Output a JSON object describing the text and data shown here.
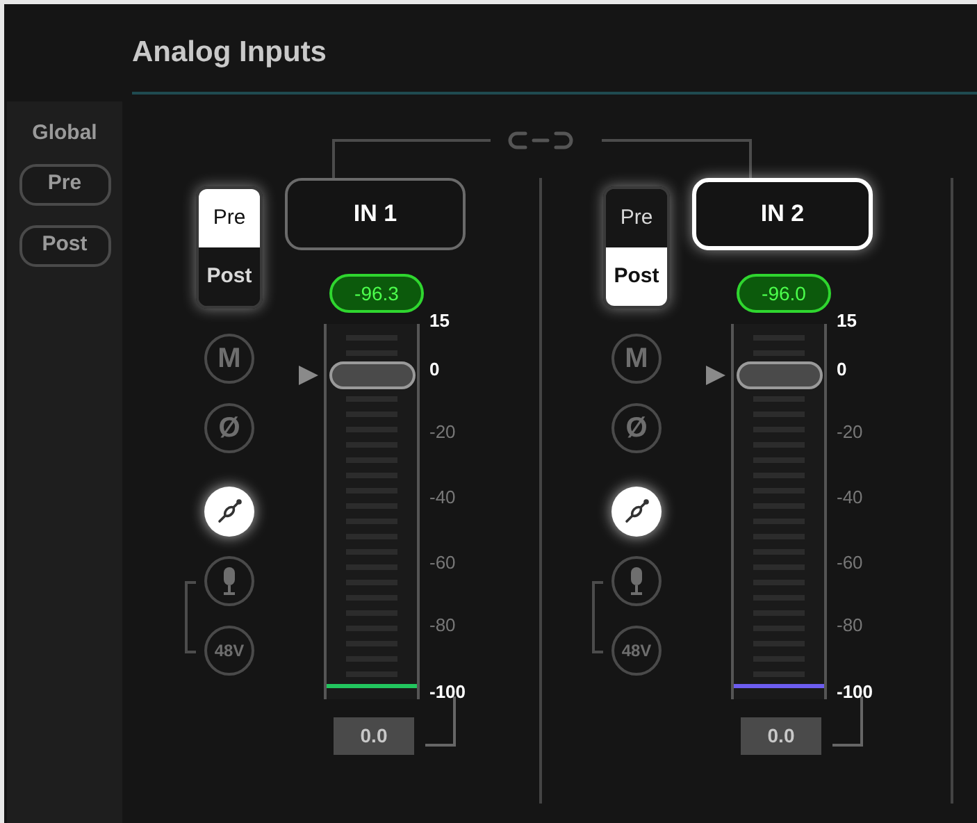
{
  "title": "Analog Inputs",
  "global": {
    "label": "Global",
    "buttons": [
      {
        "label": "Pre"
      },
      {
        "label": "Post"
      }
    ]
  },
  "channels": [
    {
      "name": "IN 1",
      "selected": false,
      "tap": [
        {
          "label": "Pre",
          "selected": true
        },
        {
          "label": "Post",
          "selected": false
        }
      ],
      "peak": "-96.3",
      "buttons": [
        {
          "kind": "mute",
          "label": "M",
          "on": false
        },
        {
          "kind": "phase",
          "label": "Ø",
          "on": false
        },
        {
          "kind": "plug",
          "on": true
        },
        {
          "kind": "mic",
          "on": false
        },
        {
          "kind": "phantom",
          "label": "48V",
          "on": false
        }
      ],
      "fader": {
        "level": 0.87
      },
      "meter": {
        "level": 0.02,
        "color": "#22c55e"
      },
      "scale": [
        {
          "label": "15",
          "kind": "major"
        },
        {
          "label": "0",
          "kind": "major"
        },
        {
          "label": "-20",
          "kind": "minor"
        },
        {
          "label": "-40",
          "kind": "minor"
        },
        {
          "label": "-60",
          "kind": "minor"
        },
        {
          "label": "-80",
          "kind": "minor"
        },
        {
          "label": "-100",
          "kind": "major"
        }
      ],
      "gain": "0.0"
    },
    {
      "name": "IN 2",
      "selected": true,
      "tap": [
        {
          "label": "Pre",
          "selected": false
        },
        {
          "label": "Post",
          "selected": true
        }
      ],
      "peak": "-96.0",
      "buttons": [
        {
          "kind": "mute",
          "label": "M",
          "on": false
        },
        {
          "kind": "phase",
          "label": "Ø",
          "on": false
        },
        {
          "kind": "plug",
          "on": true
        },
        {
          "kind": "mic",
          "on": false
        },
        {
          "kind": "phantom",
          "label": "48V",
          "on": false
        }
      ],
      "fader": {
        "level": 0.87
      },
      "meter": {
        "level": 0.02,
        "color": "#6d5df0"
      },
      "scale": [
        {
          "label": "15",
          "kind": "major"
        },
        {
          "label": "0",
          "kind": "major"
        },
        {
          "label": "-20",
          "kind": "minor"
        },
        {
          "label": "-40",
          "kind": "minor"
        },
        {
          "label": "-60",
          "kind": "minor"
        },
        {
          "label": "-80",
          "kind": "minor"
        },
        {
          "label": "-100",
          "kind": "major"
        }
      ],
      "gain": "0.0"
    }
  ]
}
